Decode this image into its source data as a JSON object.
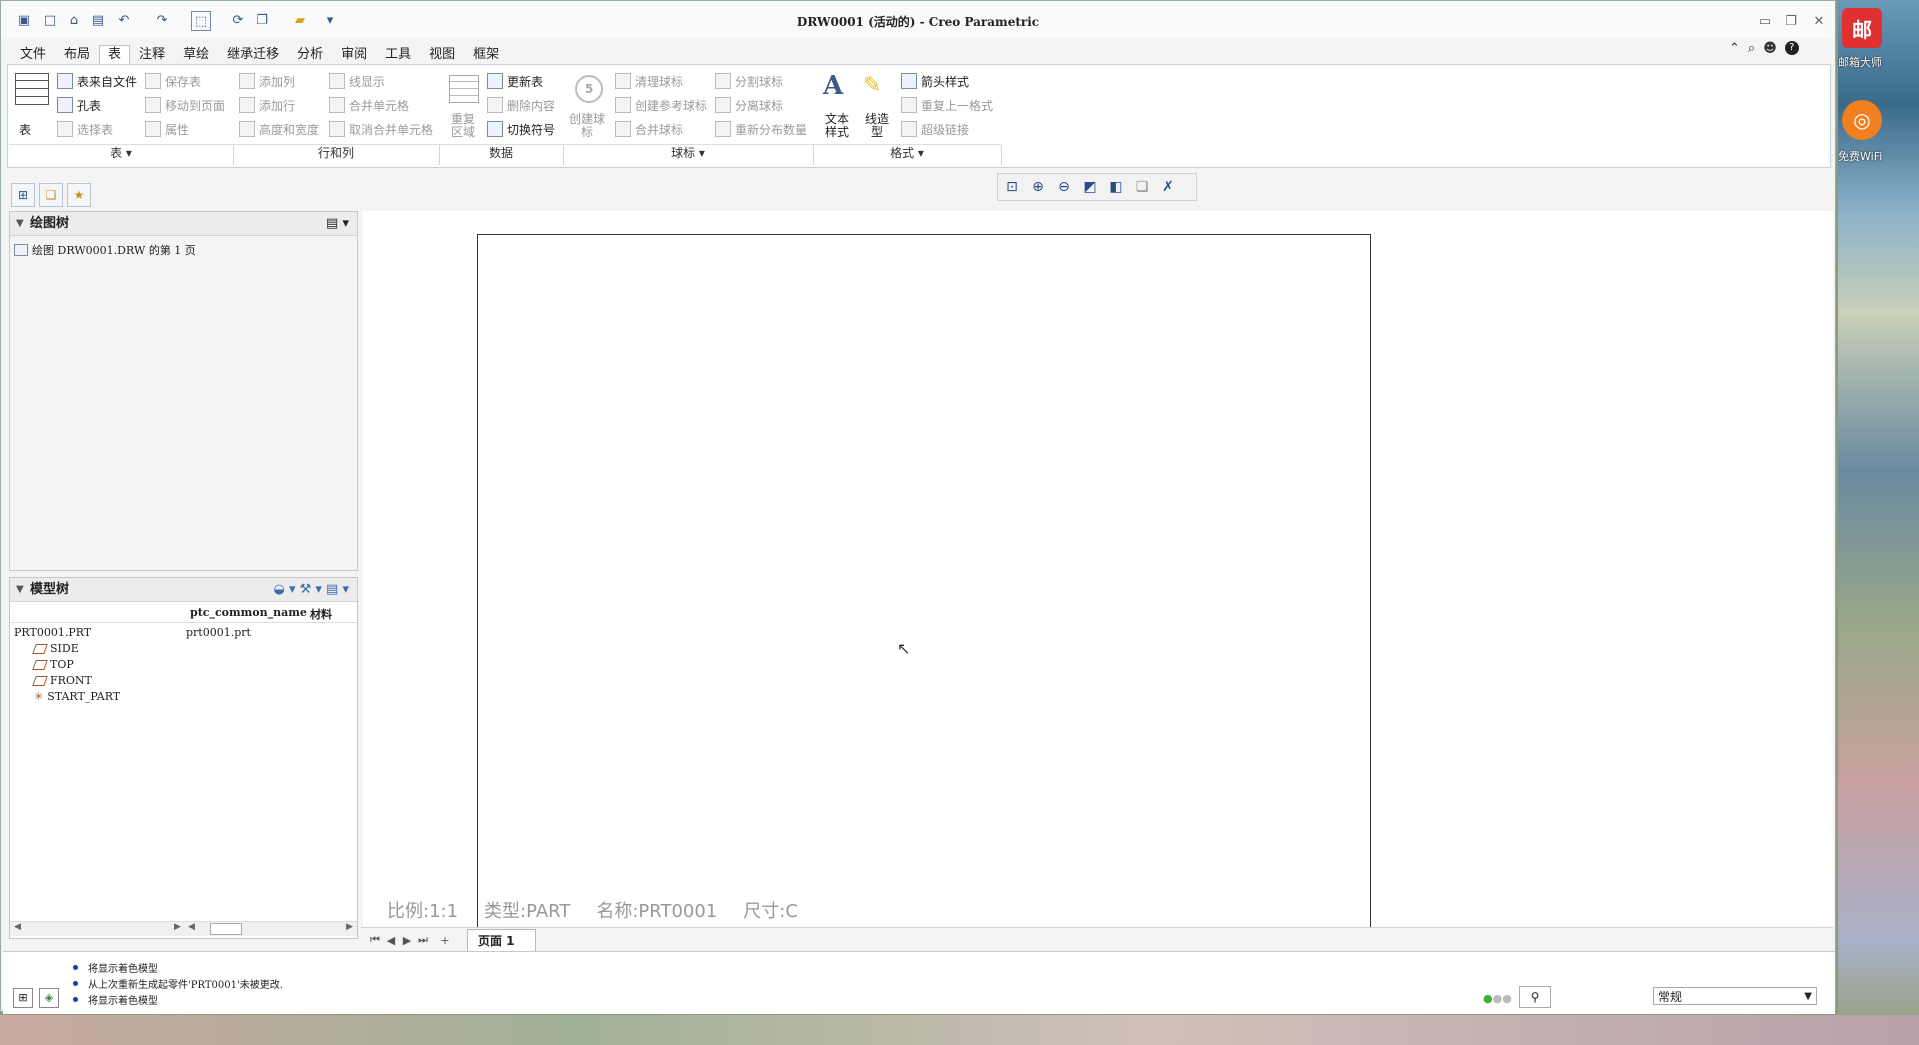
{
  "window": {
    "title": "DRW0001 (活动的) - Creo Parametric"
  },
  "desktop": {
    "icons": [
      {
        "name": "youjian-icon",
        "glyph": "邮",
        "color": "#e03030",
        "label": "邮箱大师"
      },
      {
        "name": "wifi-icon",
        "glyph": "◎",
        "color": "#f08020",
        "label": "免费WiFi"
      }
    ]
  },
  "quick_access": [
    "new-icon",
    "open-icon",
    "save-icon",
    "undo-icon",
    "redo-icon",
    "select-box-icon",
    "regenerate-icon",
    "windows-icon",
    "close-window-icon",
    "customize-icon"
  ],
  "ribbon_tabs": [
    {
      "label": "文件",
      "id": "file"
    },
    {
      "label": "布局",
      "id": "layout"
    },
    {
      "label": "表",
      "id": "table",
      "active": true
    },
    {
      "label": "注释",
      "id": "annotate"
    },
    {
      "label": "草绘",
      "id": "sketch"
    },
    {
      "label": "继承迁移",
      "id": "legacy"
    },
    {
      "label": "分析",
      "id": "analysis"
    },
    {
      "label": "审阅",
      "id": "review"
    },
    {
      "label": "工具",
      "id": "tools"
    },
    {
      "label": "视图",
      "id": "view"
    },
    {
      "label": "框架",
      "id": "framework"
    }
  ],
  "ribbon": {
    "table_group": {
      "big_label": "表",
      "table_from_file": "表来自文件",
      "hole_table": "孔表",
      "save_table": "保存表",
      "move_to_page": "移动到页面",
      "select_table": "选择表",
      "properties": "属性",
      "group_label": "表"
    },
    "rows_cols_group": {
      "add_column": "添加列",
      "add_row": "添加行",
      "height_width": "高度和宽度",
      "line_display": "线显示",
      "merge_cells": "合并单元格",
      "unmerge_cells": "取消合并单元格",
      "group_label": "行和列"
    },
    "data_group": {
      "repeat_region_l1": "重复",
      "repeat_region_l2": "区域",
      "update_table": "更新表",
      "delete_content": "删除内容",
      "switch_symbol": "切换符号",
      "group_label": "数据"
    },
    "balloon_group": {
      "create_balloon_l1": "创建球",
      "create_balloon_l2": "标",
      "clean_balloons": "清理球标",
      "create_ref_balloon": "创建参考球标",
      "merge_balloons": "合并球标",
      "split_balloons": "分割球标",
      "detach_balloons": "分离球标",
      "redistribute_qty": "重新分布数量",
      "group_label": "球标"
    },
    "format_group": {
      "text_style_l1": "文本",
      "text_style_l2": "样式",
      "line_type_l1": "线造",
      "line_type_l2": "型",
      "arrow_style": "箭头样式",
      "repeat_last_format": "重复上一格式",
      "hyperlink": "超级链接",
      "group_label": "格式"
    }
  },
  "drawing_tree": {
    "title": "绘图树",
    "item": "绘图 DRW0001.DRW 的第 1 页"
  },
  "model_tree": {
    "title": "模型树",
    "columns": [
      "",
      "ptc_common_name",
      "材料"
    ],
    "root": {
      "name": "PRT0001.PRT",
      "common_name": "prt0001.prt"
    },
    "children": [
      "SIDE",
      "TOP",
      "FRONT",
      "START_PART"
    ]
  },
  "sheet_info": {
    "scale": "比例:1:1",
    "type": "类型:PART",
    "name": "名称:PRT0001",
    "size": "尺寸:C"
  },
  "page_tab": {
    "label": "页面 1"
  },
  "messages": [
    "将显示着色模型",
    "从上次重新生成起零件'PRT0001'未被更改.",
    "将显示着色模型"
  ],
  "filter": {
    "value": "常规"
  },
  "colors": {
    "accent": "#2a5a9a",
    "ribbon_border": "#c8d0dc"
  }
}
